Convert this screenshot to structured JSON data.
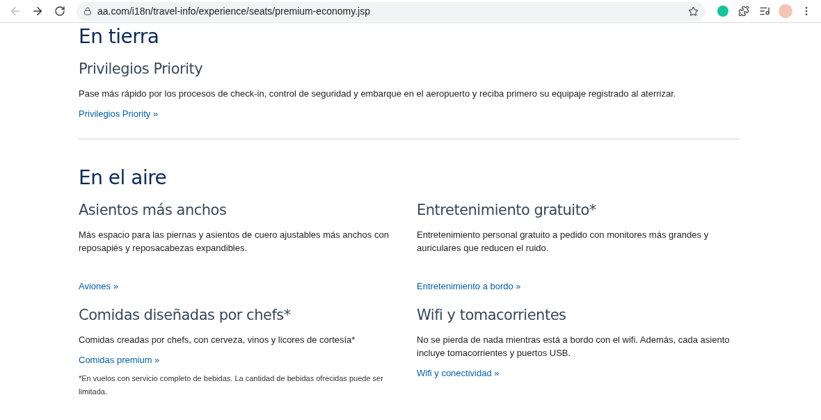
{
  "browser": {
    "url": "aa.com/i18n/travel-info/experience/seats/premium-economy.jsp"
  },
  "sections": [
    {
      "title": "En tierra",
      "rows": [
        [
          {
            "title": "Privilegios Priority",
            "text": "Pase más rápido por los procesos de check-in, control de seguridad y embarque en el aeropuerto y reciba primero su equipaje registrado al aterrizar.",
            "link": "Privilegios Priority »"
          }
        ]
      ]
    },
    {
      "title": "En el aire",
      "rows": [
        [
          {
            "title": "Asientos más anchos",
            "text": "Más espacio para las piernas y asientos de cuero ajustables más anchos con reposapiés y reposacabezas expandibles.",
            "link": "Aviones »"
          },
          {
            "title": "Entretenimiento gratuito*",
            "text": "Entretenimiento personal gratuito a pedido con monitores más grandes y auriculares que reducen el ruido.",
            "link": "Entretenimiento a bordo »"
          }
        ],
        [
          {
            "title": "Comidas diseñadas por chefs*",
            "text": "Comidas creadas por chefs, con cerveza, vinos y licores de cortesía*",
            "link": "Comidas premium »",
            "note": "*En vuelos con servicio completo de bebidas. La cantidad de bebidas ofrecidas puede ser limitada."
          },
          {
            "title": "Wifi y tomacorrientes",
            "text": "No se pierda de nada mientras está a bordo con el wifi. Además, cada asiento incluye tomacorrientes y puertos USB.",
            "link": "Wifi y conectividad »"
          }
        ]
      ]
    }
  ]
}
